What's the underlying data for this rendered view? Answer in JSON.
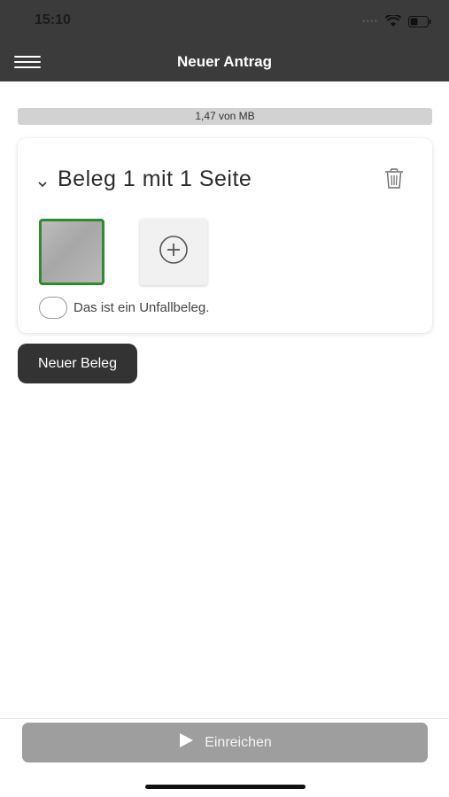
{
  "status_bar": {
    "time": "15:10",
    "signal_icon": "signal-dots",
    "wifi_icon": "wifi-icon",
    "battery_icon": "battery-icon"
  },
  "header": {
    "title": "Neuer Antrag",
    "menu_icon": "hamburger-menu-icon"
  },
  "upload_progress": {
    "label": "1,47 von MB"
  },
  "receipt_card": {
    "title": "Beleg 1 mit 1 Seite",
    "accident_label": "Das ist ein Unfallbeleg.",
    "thumbnail_border_color": "#2e8b2e"
  },
  "buttons": {
    "new_receipt": "Neuer Beleg",
    "submit": "Einreichen"
  },
  "colors": {
    "header_bg": "#3b3b3b",
    "primary_dark": "#333333",
    "submit_bg": "#9e9e9e"
  }
}
